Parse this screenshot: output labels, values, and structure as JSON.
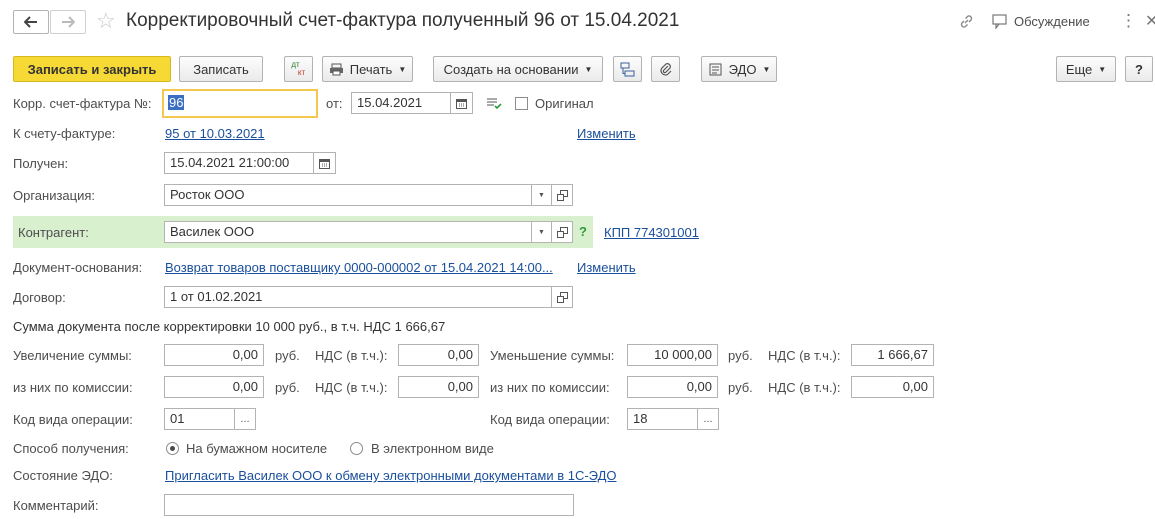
{
  "header": {
    "title": "Корректировочный счет-фактура полученный 96 от 15.04.2021",
    "discussion": "Обсуждение"
  },
  "toolbar": {
    "save_close": "Записать и закрыть",
    "save": "Записать",
    "dtkt_top": "дт",
    "dtkt_bottom": "кт",
    "print": "Печать",
    "create_based": "Создать на основании",
    "edo": "ЭДО",
    "more": "Еще",
    "help": "?"
  },
  "form": {
    "corr_invoice_label": "Корр. счет-фактура №:",
    "corr_invoice_number": "96",
    "from_label": "от:",
    "from_date": "15.04.2021",
    "original_label": "Оригинал",
    "to_invoice_label": "К счету-фактуре:",
    "to_invoice_link": "95 от 10.03.2021",
    "change_link": "Изменить",
    "received_label": "Получен:",
    "received_datetime": "15.04.2021 21:00:00",
    "org_label": "Организация:",
    "org_value": "Росток ООО",
    "counterparty_label": "Контрагент:",
    "counterparty_value": "Василек ООО",
    "kpp_link": "КПП 774301001",
    "base_doc_label": "Документ-основания:",
    "base_doc_link": "Возврат товаров поставщику 0000-000002 от 15.04.2021 14:00...",
    "change_link2": "Изменить",
    "contract_label": "Договор:",
    "contract_value": "1 от 01.02.2021",
    "summary": "Сумма документа после корректировки 10 000 руб., в т.ч. НДС 1 666,67",
    "increase_label": "Увеличение суммы:",
    "increase_value": "0,00",
    "rub": "руб.",
    "vat_label": "НДС (в т.ч.):",
    "increase_vat": "0,00",
    "decrease_label": "Уменьшение суммы:",
    "decrease_value": "10 000,00",
    "decrease_vat": "1 666,67",
    "commission_label": "из них по комиссии:",
    "commission_inc_value": "0,00",
    "commission_inc_vat": "0,00",
    "commission_dec_value": "0,00",
    "commission_dec_vat": "0,00",
    "op_code_label": "Код вида операции:",
    "op_code_left": "01",
    "op_code_right": "18",
    "receive_method_label": "Способ получения:",
    "paper_option": "На бумажном носителе",
    "electronic_option": "В электронном виде",
    "edo_state_label": "Состояние ЭДО:",
    "edo_invite_link": "Пригласить Василек ООО к обмену электронными документами в 1С-ЭДО",
    "comment_label": "Комментарий:",
    "comment_value": ""
  },
  "colors": {
    "accent_yellow": "#f7d935",
    "counterparty_bg": "#d9f0cf",
    "link": "#1a4f9c",
    "focus_border": "#f2c94c"
  }
}
